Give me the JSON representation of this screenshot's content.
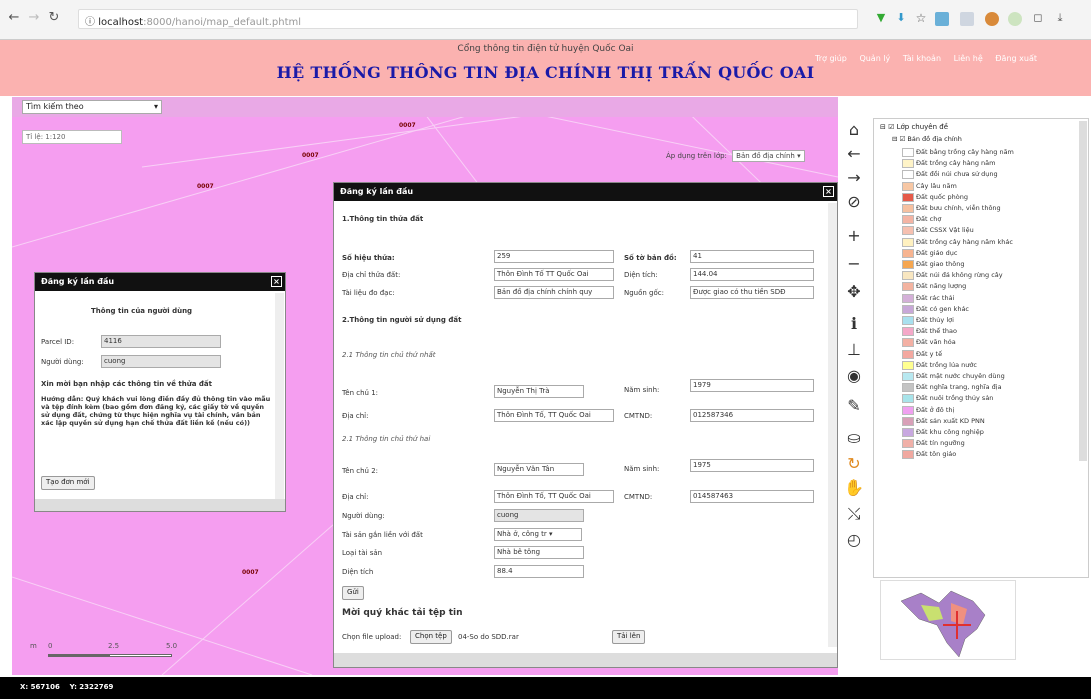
{
  "browser": {
    "url_host": "localhost",
    "url_path": ":8000/hanoi/map_default.phtml"
  },
  "header": {
    "subtitle": "Cổng thông tin điện tử huyện Quốc Oai",
    "title": "HỆ THỐNG THÔNG TIN ĐỊA CHÍNH THỊ TRẤN QUỐC OAI",
    "links": [
      "Trợ giúp",
      "Quản lý",
      "Tài khoản",
      "Liên hệ",
      "Đăng xuất"
    ]
  },
  "map": {
    "search_label": "Tìm kiếm theo",
    "scale_value": "Tỉ lệ: 1:120",
    "apply_label": "Áp dụng trên lớp:",
    "apply_select": "Bản đồ địa chính",
    "parcel_labels": [
      "0007",
      "0007",
      "0007",
      "0007"
    ],
    "scale_ticks": [
      "0",
      "2.5",
      "5.0"
    ],
    "scale_unit": "m"
  },
  "dialog_small": {
    "title": "Đăng ký lần đầu",
    "heading": "Thông tin của người dùng",
    "parcel_label": "Parcel ID:",
    "parcel_value": "4116",
    "user_label": "Người dùng:",
    "user_value": "cuong",
    "prompt": "Xin mời bạn nhập các thông tin về thửa đất",
    "guide": "Hướng dẫn: Quý khách vui lòng điền đầy đủ thông tin vào mẫu và tệp đính kèm (bao gồm đơn đăng ký, các giấy tờ về quyền sử dụng đất, chứng từ thực hiện nghĩa vụ tài chính, văn bản xác lập quyền sử dụng hạn chế thửa đất liền kề (nếu có))",
    "new_button": "Tạo đơn mới"
  },
  "dialog_main": {
    "title": "Đăng ký lần đầu",
    "section1": "1.Thông tin thửa đất",
    "parcel_no_label": "Số hiệu thửa:",
    "parcel_no": "259",
    "map_sheet_label": "Số tờ bản đồ:",
    "map_sheet": "41",
    "address_label": "Địa chỉ thửa đất:",
    "address": "Thôn Đình Tố TT Quốc Oai",
    "area_label": "Diện tích:",
    "area": "144.04",
    "document_label": "Tài liệu đo đạc:",
    "document": "Bản đồ địa chính chính quy",
    "origin_label": "Nguồn gốc:",
    "origin": "Được giao có thu tiền SDĐ",
    "section2": "2.Thông tin người sử dụng đất",
    "owner1_heading": "2.1 Thông tin chủ thứ nhất",
    "owner1_name_label": "Tên chủ 1:",
    "owner1_name": "Nguyễn Thị Trà",
    "year_label": "Năm sinh:",
    "owner1_year": "1979",
    "owner_addr_label": "Địa chỉ:",
    "owner1_addr": "Thôn Đình Tố, TT Quốc Oai",
    "id_label": "CMTND:",
    "owner1_id": "012587346",
    "owner2_heading": "2.1 Thông tin chủ thứ hai",
    "owner2_name_label": "Tên chủ 2:",
    "owner2_name": "Nguyễn Văn Tân",
    "owner2_year": "1975",
    "owner2_addr": "Thôn Đình Tố, TT Quốc Oai",
    "owner2_id": "014587463",
    "user_label": "Người dùng:",
    "user_value": "cuong",
    "asset_label": "Tài sản gắn liền với đất",
    "asset_select": "Nhà ở, công tr",
    "asset_type_label": "Loại tài sản",
    "asset_type": "Nhà bê tông",
    "asset_area_label": "Diện tích",
    "asset_area": "88.4",
    "send_button": "Gửi",
    "upload_heading": "Mời quý khác tải tệp tin",
    "upload_label": "Chọn file upload:",
    "choose_button": "Chọn tệp",
    "file_name": "04-So do SDD.rar",
    "upload_button": "Tải lên"
  },
  "layers": {
    "root": "Lớp chuyên đề",
    "group": "Bản đồ địa chính",
    "items": [
      {
        "label": "Đất bằng trồng cây hàng năm",
        "color": "#ffffff"
      },
      {
        "label": "Đất trồng cây hàng năm",
        "color": "#fff4c8"
      },
      {
        "label": "Đất đồi núi chưa sử dụng",
        "color": "#ffffff"
      },
      {
        "label": "Cây lâu năm",
        "color": "#f7c7a4"
      },
      {
        "label": "Đất quốc phòng",
        "color": "#e55a4a"
      },
      {
        "label": "Đất bưu chính, viễn thông",
        "color": "#f6c0a0"
      },
      {
        "label": "Đất chợ",
        "color": "#f4b4a4"
      },
      {
        "label": "Đất CSSX Vật liệu",
        "color": "#f6c0b0"
      },
      {
        "label": "Đất trồng cây hàng năm khác",
        "color": "#fff1c0"
      },
      {
        "label": "Đất giáo dục",
        "color": "#f7b490"
      },
      {
        "label": "Đất giao thông",
        "color": "#f5a650"
      },
      {
        "label": "Đất núi đá không rừng cây",
        "color": "#f8e6c0"
      },
      {
        "label": "Đất năng lượng",
        "color": "#f3b3a0"
      },
      {
        "label": "Đất rác thải",
        "color": "#d4b0d8"
      },
      {
        "label": "Đất có gen khác",
        "color": "#c8a8d8"
      },
      {
        "label": "Đất thủy lợi",
        "color": "#a8e0ee"
      },
      {
        "label": "Đất thể thao",
        "color": "#f4a8c8"
      },
      {
        "label": "Đất văn hóa",
        "color": "#f3b0a4"
      },
      {
        "label": "Đất y tế",
        "color": "#f3a8a0"
      },
      {
        "label": "Đất trồng lúa nước",
        "color": "#ffff90"
      },
      {
        "label": "Đất mặt nước chuyên dùng",
        "color": "#b8e8f0"
      },
      {
        "label": "Đất nghĩa trang, nghĩa địa",
        "color": "#c4c4c4"
      },
      {
        "label": "Đất nuôi trồng thủy sản",
        "color": "#a8e4ea"
      },
      {
        "label": "Đất ở đô thị",
        "color": "#f0a0f0"
      },
      {
        "label": "Đất sản xuất KD PNN",
        "color": "#d8a0b8"
      },
      {
        "label": "Đất khu công nghiệp",
        "color": "#c8a8e0"
      },
      {
        "label": "Đất tín ngưỡng",
        "color": "#f0b0a8"
      },
      {
        "label": "Đất tôn giáo",
        "color": "#f0a8a0"
      }
    ]
  },
  "status": {
    "x": "X: 567106",
    "y": "Y: 2322769"
  }
}
